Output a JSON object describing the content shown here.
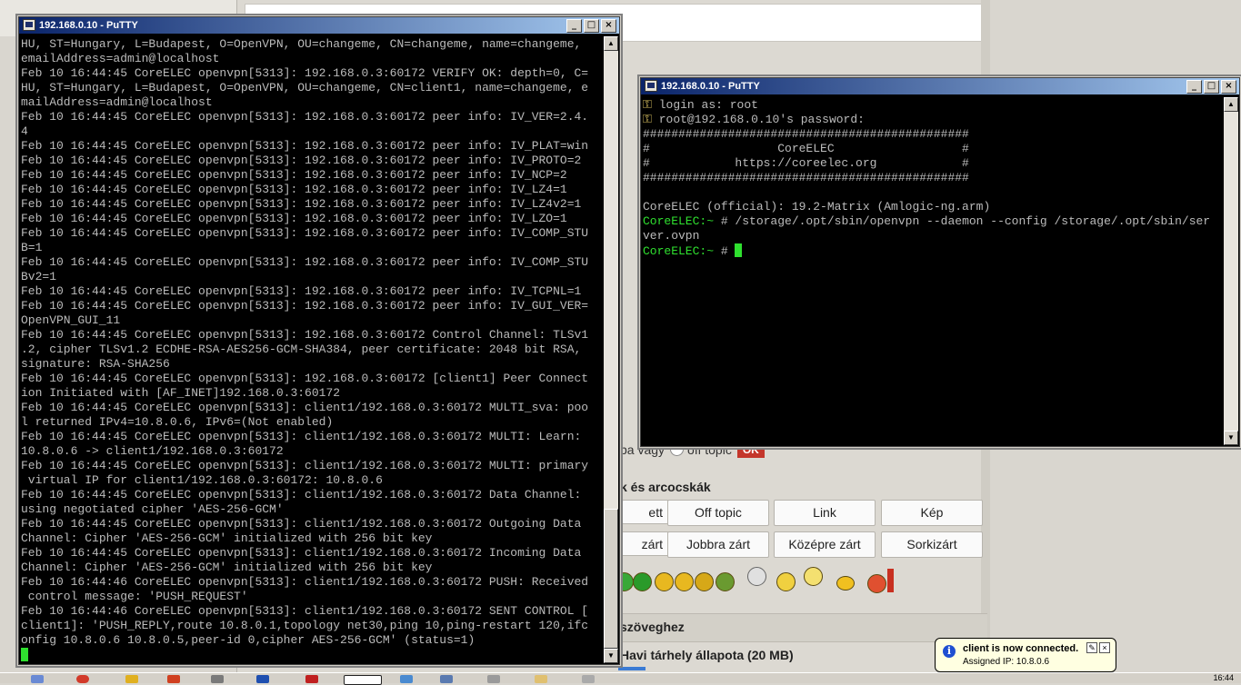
{
  "browser": {
    "radio_row_prefix": "ba vagy",
    "radio_label": "off topic",
    "ok_label": "OK",
    "section_smileys": "k és arcocskák",
    "format_buttons_row1": [
      "ett",
      "Off topic",
      "Link",
      "Kép"
    ],
    "format_buttons_row2": [
      "zárt",
      "Jobbra zárt",
      "Középre zárt",
      "Sorkizárt"
    ],
    "bar_text": "szöveghez",
    "storage_text": "Havi tárhely állapota (20 MB)"
  },
  "putty_left": {
    "title": "192.168.0.10 - PuTTY",
    "lines": [
      "HU, ST=Hungary, L=Budapest, O=OpenVPN, OU=changeme, CN=changeme, name=changeme,",
      "emailAddress=admin@localhost",
      "Feb 10 16:44:45 CoreELEC openvpn[5313]: 192.168.0.3:60172 VERIFY OK: depth=0, C=",
      "HU, ST=Hungary, L=Budapest, O=OpenVPN, OU=changeme, CN=client1, name=changeme, e",
      "mailAddress=admin@localhost",
      "Feb 10 16:44:45 CoreELEC openvpn[5313]: 192.168.0.3:60172 peer info: IV_VER=2.4.",
      "4",
      "Feb 10 16:44:45 CoreELEC openvpn[5313]: 192.168.0.3:60172 peer info: IV_PLAT=win",
      "Feb 10 16:44:45 CoreELEC openvpn[5313]: 192.168.0.3:60172 peer info: IV_PROTO=2",
      "Feb 10 16:44:45 CoreELEC openvpn[5313]: 192.168.0.3:60172 peer info: IV_NCP=2",
      "Feb 10 16:44:45 CoreELEC openvpn[5313]: 192.168.0.3:60172 peer info: IV_LZ4=1",
      "Feb 10 16:44:45 CoreELEC openvpn[5313]: 192.168.0.3:60172 peer info: IV_LZ4v2=1",
      "Feb 10 16:44:45 CoreELEC openvpn[5313]: 192.168.0.3:60172 peer info: IV_LZO=1",
      "Feb 10 16:44:45 CoreELEC openvpn[5313]: 192.168.0.3:60172 peer info: IV_COMP_STU",
      "B=1",
      "Feb 10 16:44:45 CoreELEC openvpn[5313]: 192.168.0.3:60172 peer info: IV_COMP_STU",
      "Bv2=1",
      "Feb 10 16:44:45 CoreELEC openvpn[5313]: 192.168.0.3:60172 peer info: IV_TCPNL=1",
      "Feb 10 16:44:45 CoreELEC openvpn[5313]: 192.168.0.3:60172 peer info: IV_GUI_VER=",
      "OpenVPN_GUI_11",
      "Feb 10 16:44:45 CoreELEC openvpn[5313]: 192.168.0.3:60172 Control Channel: TLSv1",
      ".2, cipher TLSv1.2 ECDHE-RSA-AES256-GCM-SHA384, peer certificate: 2048 bit RSA,",
      "signature: RSA-SHA256",
      "Feb 10 16:44:45 CoreELEC openvpn[5313]: 192.168.0.3:60172 [client1] Peer Connect",
      "ion Initiated with [AF_INET]192.168.0.3:60172",
      "Feb 10 16:44:45 CoreELEC openvpn[5313]: client1/192.168.0.3:60172 MULTI_sva: poo",
      "l returned IPv4=10.8.0.6, IPv6=(Not enabled)",
      "Feb 10 16:44:45 CoreELEC openvpn[5313]: client1/192.168.0.3:60172 MULTI: Learn:",
      "10.8.0.6 -> client1/192.168.0.3:60172",
      "Feb 10 16:44:45 CoreELEC openvpn[5313]: client1/192.168.0.3:60172 MULTI: primary",
      " virtual IP for client1/192.168.0.3:60172: 10.8.0.6",
      "Feb 10 16:44:45 CoreELEC openvpn[5313]: client1/192.168.0.3:60172 Data Channel:",
      "using negotiated cipher 'AES-256-GCM'",
      "Feb 10 16:44:45 CoreELEC openvpn[5313]: client1/192.168.0.3:60172 Outgoing Data",
      "Channel: Cipher 'AES-256-GCM' initialized with 256 bit key",
      "Feb 10 16:44:45 CoreELEC openvpn[5313]: client1/192.168.0.3:60172 Incoming Data",
      "Channel: Cipher 'AES-256-GCM' initialized with 256 bit key",
      "Feb 10 16:44:46 CoreELEC openvpn[5313]: client1/192.168.0.3:60172 PUSH: Received",
      " control message: 'PUSH_REQUEST'",
      "Feb 10 16:44:46 CoreELEC openvpn[5313]: client1/192.168.0.3:60172 SENT CONTROL [",
      "client1]: 'PUSH_REPLY,route 10.8.0.1,topology net30,ping 10,ping-restart 120,ifc",
      "onfig 10.8.0.6 10.8.0.5,peer-id 0,cipher AES-256-GCM' (status=1)"
    ]
  },
  "putty_right": {
    "title": "192.168.0.10 - PuTTY",
    "login_line": "login as: root",
    "password_line": "root@192.168.0.10's password:",
    "banner": [
      "##############################################",
      "#                  CoreELEC                  #",
      "#            https://coreelec.org            #",
      "##############################################"
    ],
    "version_line": "CoreELEC (official): 19.2-Matrix (Amlogic-ng.arm)",
    "prompt": "CoreELEC:~",
    "prompt_suffix": " # ",
    "command_line1": "/storage/.opt/sbin/openvpn --daemon --config /storage/.opt/sbin/ser",
    "command_line2": "ver.ovpn"
  },
  "notification": {
    "title": "client is now connected.",
    "body": "Assigned IP: 10.8.0.6"
  },
  "taskbar": {
    "clock": "16:44"
  }
}
